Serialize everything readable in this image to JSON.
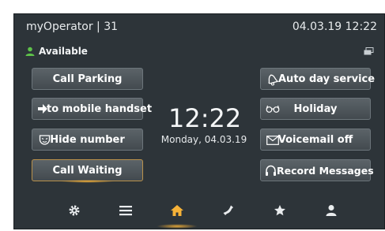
{
  "header": {
    "title": "myOperator | 31",
    "datetime": "04.03.19  12:22"
  },
  "status": {
    "label": "Available",
    "color": "#5ec24a"
  },
  "left_buttons": [
    {
      "label": "Call Parking"
    },
    {
      "label": "to mobile handset"
    },
    {
      "label": "Hide number"
    },
    {
      "label": "Call Waiting"
    }
  ],
  "right_buttons": [
    {
      "label": "Auto day service"
    },
    {
      "label": "Holiday"
    },
    {
      "label": "Voicemail off"
    },
    {
      "label": "Record Messages"
    }
  ],
  "clock": {
    "time": "12:22",
    "date": "Monday, 04.03.19"
  },
  "nav": [
    "settings-icon",
    "menu-icon",
    "home-icon",
    "phone-icon",
    "star-icon",
    "contact-icon"
  ],
  "colors": {
    "accent": "#f6b238",
    "background": "#2d3439"
  }
}
